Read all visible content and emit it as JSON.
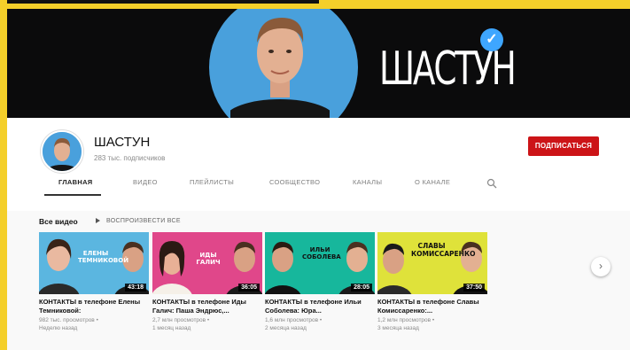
{
  "banner": {
    "title": "ШАСТУН",
    "colors": {
      "background": "#0b0b0c",
      "circle": "#49a0dc",
      "verified": "#3ea6ff"
    }
  },
  "channel": {
    "name": "ШАСТУН",
    "subscribers": "283 тыс. подписчиков",
    "subscribe_label": "ПОДПИСАТЬСЯ",
    "subscribe_color": "#cc1417"
  },
  "tabs": [
    {
      "label": "ГЛАВНАЯ",
      "active": true
    },
    {
      "label": "ВИДЕО",
      "active": false
    },
    {
      "label": "ПЛЕЙЛИСТЫ",
      "active": false
    },
    {
      "label": "СООБЩЕСТВО",
      "active": false
    },
    {
      "label": "КАНАЛЫ",
      "active": false
    },
    {
      "label": "О КАНАЛЕ",
      "active": false
    }
  ],
  "search_icon": "search-icon",
  "section": {
    "title": "Все видео",
    "play_all_label": "ВОСПРОИЗВЕСТИ ВСЕ"
  },
  "videos": [
    {
      "thumb_text": "ЕЛЕНЫ ТЕМНИКОВОЙ",
      "thumb_bg": "#5bb6e0",
      "duration": "43:18",
      "title": "КОНТАКТЫ в телефоне Елены Темниковой:",
      "views": "982 тыс. просмотров •",
      "age": "Неделю назад"
    },
    {
      "thumb_text": "ИДЫ ГАЛИЧ",
      "thumb_bg": "#e0478a",
      "duration": "36:05",
      "title": "КОНТАКТЫ в телефоне Иды Галич: Паша Эндрюс,...",
      "views": "2,7 млн просмотров •",
      "age": "1 месяц назад"
    },
    {
      "thumb_text": "ИЛЬИ СОБОЛЕВА",
      "thumb_bg": "#17b79c",
      "duration": "28:05",
      "title": "КОНТАКТЫ в телефоне Ильи Соболева: Юра...",
      "views": "1,6 млн просмотров •",
      "age": "2 месяца назад"
    },
    {
      "thumb_text": "СЛАВЫ КОМИССАРЕНКО",
      "thumb_bg": "#dfe23a",
      "duration": "37:50",
      "title": "КОНТАКТЫ в телефоне Славы Комиссаренко:...",
      "views": "1,2 млн просмотров •",
      "age": "3 месяца назад"
    }
  ],
  "next_icon": "chevron-right-icon"
}
